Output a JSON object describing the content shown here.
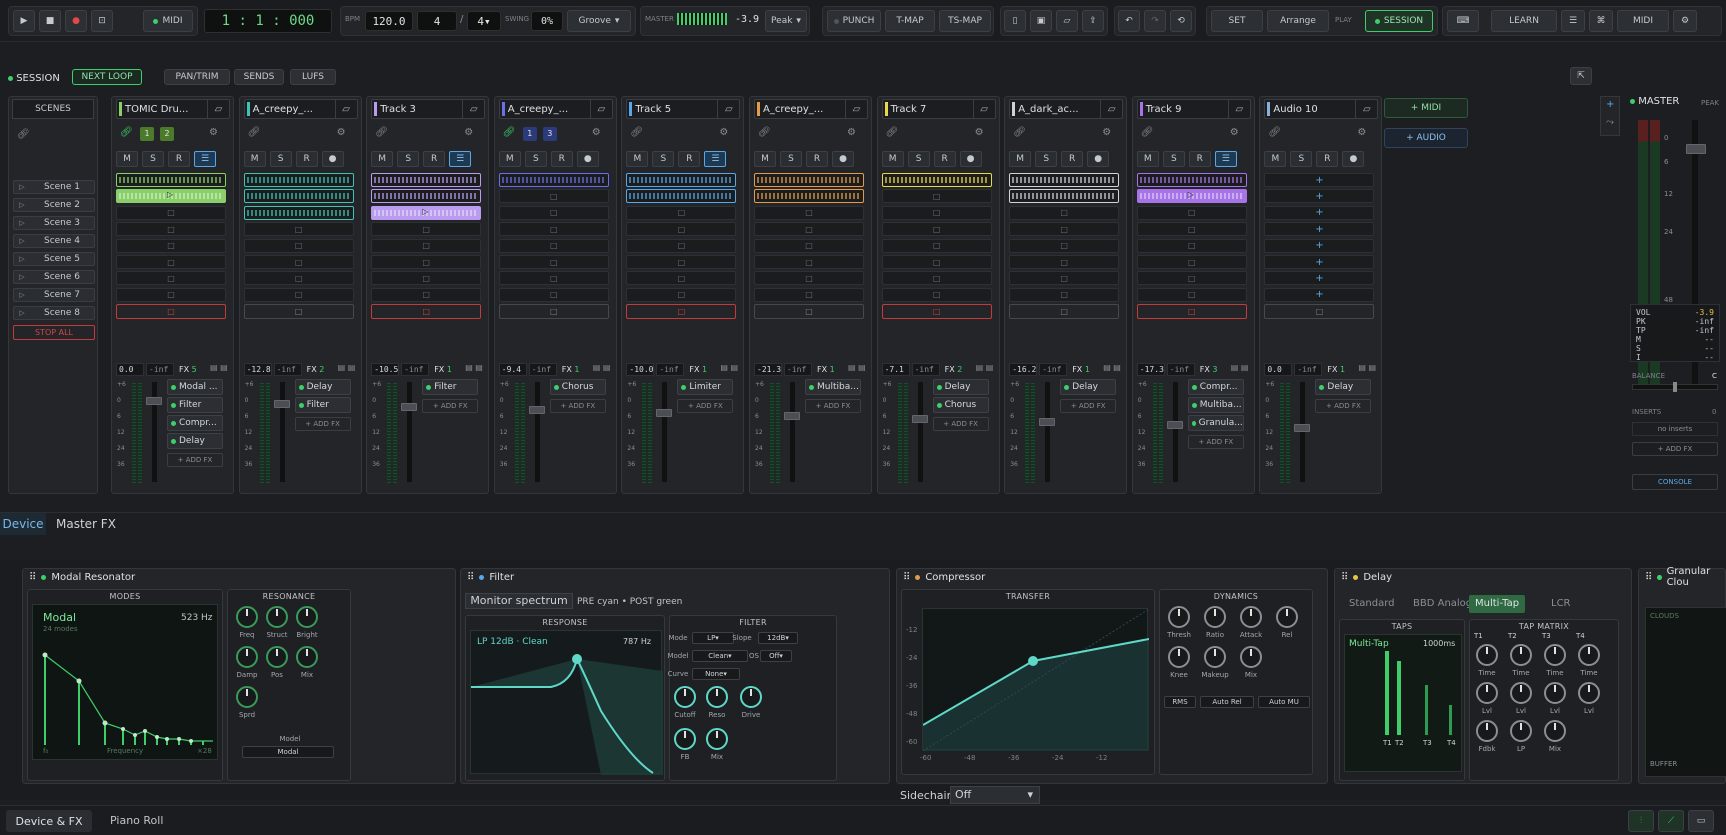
{
  "transport": {
    "midi": "MIDI",
    "position": "1 : 1 : 000",
    "bpm_label": "BPM",
    "bpm": "120.0",
    "sig_num": "4",
    "sig_den": "4",
    "swing_label": "SWING",
    "swing": "0%",
    "groove": "Groove",
    "master_label": "MASTER",
    "master_db": "-3.9",
    "peak_mode": "Peak",
    "punch": "PUNCH",
    "tmap": "T-MAP",
    "tsmap": "TS-MAP",
    "set": "SET",
    "arrange": "Arrange",
    "play_label": "PLAY",
    "session": "SESSION",
    "learn": "LEARN",
    "midi2": "MIDI"
  },
  "session_bar": {
    "title": "SESSION",
    "next_loop": "NEXT LOOP",
    "pan_trim": "PAN/TRIM",
    "sends": "SENDS",
    "lufs": "LUFS"
  },
  "scenes": {
    "header": "SCENES",
    "items": [
      "Scene 1",
      "Scene 2",
      "Scene 3",
      "Scene 4",
      "Scene 5",
      "Scene 6",
      "Scene 7",
      "Scene 8"
    ],
    "stop_all": "STOP ALL"
  },
  "msr": {
    "m": "M",
    "s": "S",
    "r": "R"
  },
  "tracks": [
    {
      "name": "TOMIC Dru...",
      "color": "#8ad06a",
      "vol": "0.0",
      "peak": "-inf",
      "fx_count": "5",
      "fx": [
        "Modal ...",
        "Filter",
        "Compr...",
        "Delay"
      ],
      "nums": [
        "1",
        "2"
      ]
    },
    {
      "name": "A_creepy_...",
      "color": "#3fc3b5",
      "vol": "-12.8",
      "peak": "-inf",
      "fx_count": "2",
      "fx": [
        "Delay",
        "Filter"
      ]
    },
    {
      "name": "Track 3",
      "color": "#b99cf0",
      "vol": "-10.5",
      "peak": "-inf",
      "fx_count": "1",
      "fx": [
        "Filter"
      ]
    },
    {
      "name": "A_creepy_...",
      "color": "#6b6fe8",
      "vol": "-9.4",
      "peak": "-inf",
      "fx_count": "1",
      "fx": [
        "Chorus"
      ],
      "nums": [
        "1",
        "3"
      ]
    },
    {
      "name": "Track 5",
      "color": "#58a7e8",
      "vol": "-10.0",
      "peak": "-inf",
      "fx_count": "1",
      "fx": [
        "Limiter"
      ]
    },
    {
      "name": "A_creepy_...",
      "color": "#e39a4a",
      "vol": "-21.3",
      "peak": "-inf",
      "fx_count": "1",
      "fx": [
        "Multiba..."
      ]
    },
    {
      "name": "Track 7",
      "color": "#e8d84a",
      "vol": "-7.1",
      "peak": "-inf",
      "fx_count": "2",
      "fx": [
        "Delay",
        "Chorus"
      ]
    },
    {
      "name": "A_dark_ac...",
      "color": "#cfd2d6",
      "vol": "-16.2",
      "peak": "-inf",
      "fx_count": "1",
      "fx": [
        "Delay"
      ]
    },
    {
      "name": "Track 9",
      "color": "#a774e8",
      "vol": "-17.3",
      "peak": "-inf",
      "fx_count": "3",
      "fx": [
        "Compr...",
        "Multiba...",
        "Granula..."
      ]
    },
    {
      "name": "Audio 10",
      "color": "#8ab0d8",
      "vol": "0.0",
      "peak": "-inf",
      "fx_count": "1",
      "fx": [
        "Delay"
      ]
    }
  ],
  "add_fx": "+ ADD FX",
  "add_track": {
    "midi": "+ MIDI",
    "audio": "+ AUDIO"
  },
  "master": {
    "title": "MASTER",
    "peak": "PEAK",
    "scale": [
      "0",
      "6",
      "12",
      "24",
      "48"
    ],
    "vol_label": "VOL",
    "vol": "-3.9",
    "pk_label": "PK",
    "pk": "-inf",
    "tp_label": "TP",
    "tp": "-inf",
    "m_label": "M",
    "m": "--",
    "s_label": "S",
    "s": "--",
    "i_label": "I",
    "i": "--",
    "balance": "BALANCE",
    "balance_val": "C",
    "inserts": "INSERTS",
    "inserts_count": "0",
    "no_inserts": "no inserts",
    "add_fx": "+ ADD FX",
    "console": "CONSOLE"
  },
  "fader_scale": [
    "+6",
    "0",
    "6",
    "12",
    "24",
    "36"
  ],
  "dev_tabs": [
    "Device",
    "Master FX"
  ],
  "modal": {
    "title": "Modal Resonator",
    "modes": "MODES",
    "type": "Modal",
    "count": "24 modes",
    "freq": "523 Hz",
    "frequency": "Frequency",
    "f0": "f₀",
    "x28": "×28",
    "resonance": "RESONANCE",
    "knobs": [
      "Freq",
      "Struct",
      "Bright",
      "Damp",
      "Pos",
      "Mix",
      "Sprd"
    ],
    "model_label": "Model",
    "model": "Modal"
  },
  "filter": {
    "title": "Filter",
    "monitor": "Monitor spectrum",
    "pre_post": "PRE cyan • POST green",
    "response": "RESPONSE",
    "curve_label": "LP 12dB · Clean",
    "cutoff_hz": "787 Hz",
    "filter_label": "FILTER",
    "mode_label": "Mode",
    "mode": "LP",
    "slope_label": "Slope",
    "slope": "12dB",
    "model_label": "Model",
    "model": "Clean",
    "os_label": "OS",
    "os": "Off",
    "curve_label2": "Curve",
    "curve": "None",
    "knobs": [
      "Cutoff",
      "Reso",
      "Drive",
      "FB",
      "Mix"
    ]
  },
  "comp": {
    "title": "Compressor",
    "transfer": "TRANSFER",
    "dynamics": "DYNAMICS",
    "knobs": [
      "Thresh",
      "Ratio",
      "Attack",
      "Rel",
      "Knee",
      "Makeup",
      "Mix"
    ],
    "rms": "RMS",
    "auto_rel": "Auto Rel",
    "auto_mu": "Auto MU",
    "y_ticks": [
      "-12",
      "-24",
      "-36",
      "-48",
      "-60"
    ],
    "x_ticks": [
      "-60",
      "-48",
      "-36",
      "-24",
      "-12"
    ],
    "sidechain_label": "Sidechain:",
    "sidechain": "Off"
  },
  "delay": {
    "title": "Delay",
    "tabs": [
      "Standard",
      "BBD Analog",
      "Multi-Tap",
      "LCR"
    ],
    "taps": "TAPS",
    "mode": "Multi-Tap",
    "time": "1000ms",
    "tap_labels": [
      "T1",
      "T2",
      "T3",
      "T4"
    ],
    "tap_matrix": "TAP MATRIX",
    "rows": [
      "Time",
      "Time",
      "Time",
      "Time",
      "Lvl",
      "Lvl",
      "Lvl",
      "Lvl",
      "Fdbk",
      "LP",
      "Mix"
    ]
  },
  "granular": {
    "title": "Granular Clou",
    "clouds": "CLOUDS",
    "buffer": "BUFFER"
  },
  "bottom_tabs": [
    "Device & FX",
    "Piano Roll"
  ]
}
